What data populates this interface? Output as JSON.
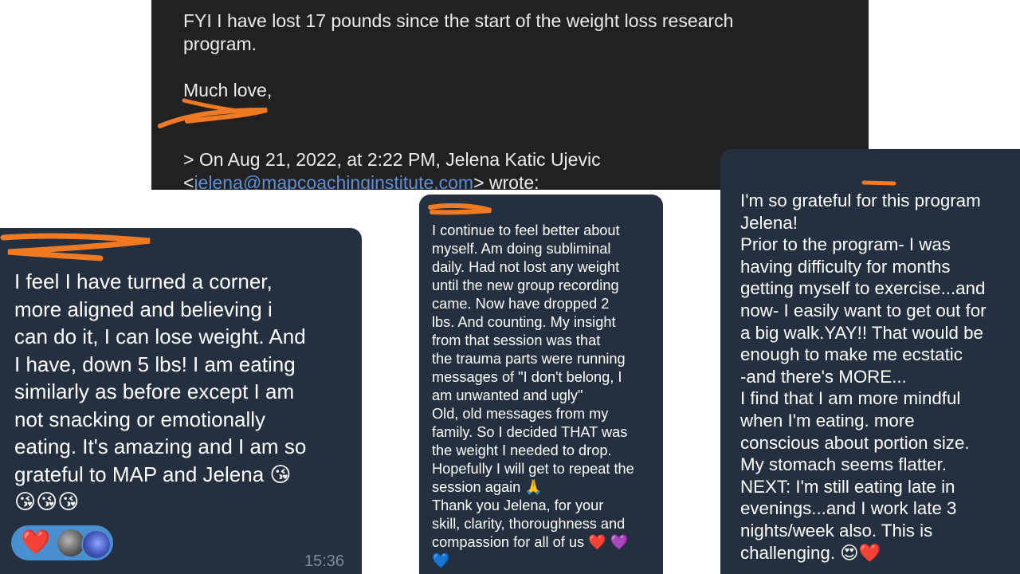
{
  "email": {
    "line1": "FYI I have lost 17 pounds since the start of the weight loss research",
    "line2": "program.",
    "signoff": "Much love,",
    "quote_header": "> On Aug 21, 2022, at 2:22 PM, Jelena Katic Ujevic",
    "quote_lt": "<",
    "quote_email": "jelena@mapcoachinginstitute.com",
    "quote_wrote": "> wrote:"
  },
  "left_message": {
    "text": "I feel I have turned a corner,\nmore aligned and believing i\ncan do it, I can lose weight. And\nI have, down 5 lbs! I am eating\nsimilarly as before except I am\nnot snacking or emotionally\neating. It's amazing and I am so\ngrateful to MAP and Jelena 😘\n😘😘😘",
    "reaction_emoji": "❤️",
    "time": "15:36"
  },
  "middle_message": {
    "text": "I continue to feel better about\nmyself.  Am doing subliminal\ndaily.  Had not lost any weight\nuntil the new group recording\ncame. Now have dropped 2\nlbs. And counting.  My insight\nfrom that session was that\nthe trauma parts were running\nmessages of \"I don't belong, I\nam unwanted and ugly\"\nOld, old messages from my\nfamily.  So I decided THAT was\nthe weight I needed to drop.\nHopefully I will get to repeat the\nsession again 🙏\nThank you Jelena, for your\nskill, clarity,  thoroughness and\ncompassion for all of us ❤️ 💜\n💙"
  },
  "right_message": {
    "text": "I'm so grateful for this program\nJelena!\n Prior to the program- I was\nhaving difficulty for months\ngetting myself to exercise...and\nnow- I easily want to get out for\na big walk.YAY!! That would be\nenough to make me ecstatic\n-and there's MORE...\nI find that I am more mindful\nwhen I'm eating. more\nconscious about portion size.\nMy stomach seems flatter.\nNEXT: I'm still eating late in\nevenings...and I work late 3\nnights/week also.  This is\nchallenging. 😍❤️"
  },
  "colors": {
    "email_bg": "#212121",
    "bubble_bg": "#243040",
    "link": "#5e8fd6",
    "scribble": "#f07a24",
    "reaction_bg": "#4a8fd0"
  },
  "icons": {
    "reaction_avatar_1": "avatar-gray",
    "reaction_avatar_2": "avatar-purple-flowers"
  }
}
